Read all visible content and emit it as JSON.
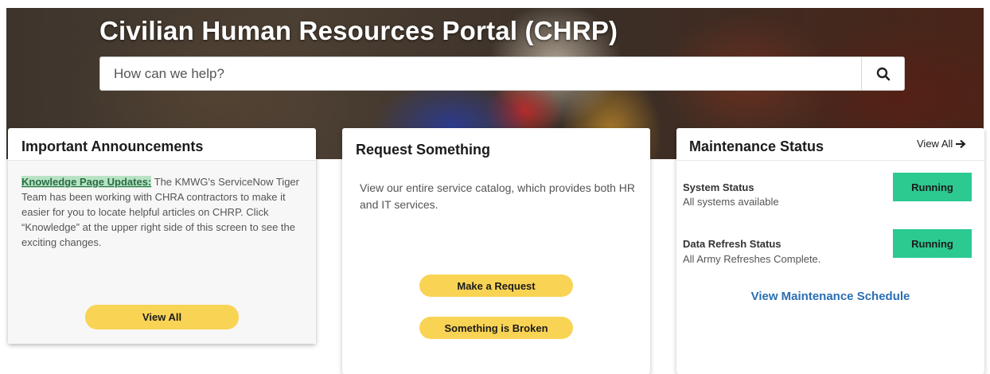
{
  "header": {
    "title": "Civilian Human Resources Portal (CHRP)",
    "search_placeholder": "How can we help?"
  },
  "announcements": {
    "title": "Important Announcements",
    "link_text": "Knowledge Page Updates:",
    "body": " The KMWG's ServiceNow Tiger Team has been working with CHRA contractors to make it easier for you to locate helpful articles on CHRP. Click “Knowledge” at the upper right side of this screen to see the exciting changes.",
    "button_label": "View All"
  },
  "request": {
    "title": "Request Something",
    "body": "View our entire service catalog, which provides both HR and IT services.",
    "make_request_label": "Make a Request",
    "broken_label": "Something is Broken"
  },
  "maintenance": {
    "title": "Maintenance Status",
    "view_all_label": "View All",
    "items": [
      {
        "label": "System Status",
        "sub": "All systems available",
        "status": "Running"
      },
      {
        "label": "Data Refresh Status",
        "sub": "All Army Refreshes Complete.",
        "status": "Running"
      }
    ],
    "schedule_link": "View Maintenance Schedule"
  },
  "colors": {
    "accent_yellow": "#f9d354",
    "status_green": "#2cc991",
    "link_blue": "#2a6fb3",
    "link_green": "#2a6e44"
  }
}
